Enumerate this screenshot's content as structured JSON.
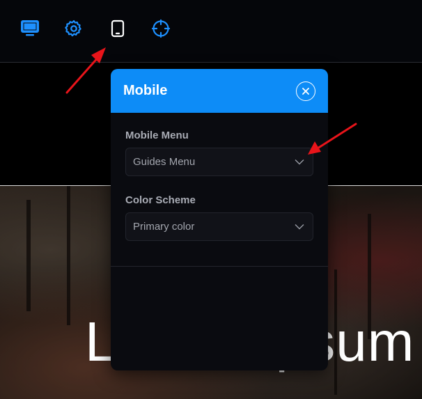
{
  "toolbar": {
    "icons": [
      {
        "name": "desktop-icon",
        "color": "#1e90ff"
      },
      {
        "name": "gear-icon",
        "color": "#1e90ff"
      },
      {
        "name": "tablet-icon",
        "color": "#ffffff"
      },
      {
        "name": "crosshair-icon",
        "color": "#1e90ff"
      }
    ]
  },
  "panel": {
    "title": "Mobile",
    "header_color": "#0d8cf7",
    "fields": [
      {
        "label": "Mobile Menu",
        "value": "Guides Menu"
      },
      {
        "label": "Color Scheme",
        "value": "Primary color"
      }
    ]
  },
  "hero": {
    "title": "Lorem ipsum"
  },
  "annotations": {
    "arrow_color": "#e8141a"
  }
}
